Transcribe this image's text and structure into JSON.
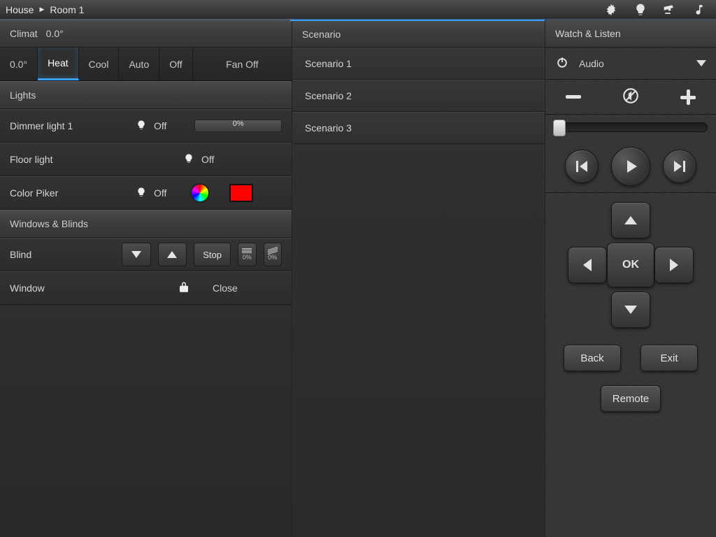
{
  "breadcrumb": {
    "root": "House",
    "room": "Room 1"
  },
  "climate": {
    "header": "Climat",
    "temp": "0.0°",
    "setpoint": "0.0°",
    "tabs": {
      "heat": "Heat",
      "cool": "Cool",
      "auto": "Auto",
      "off": "Off",
      "fanoff": "Fan Off"
    }
  },
  "lights": {
    "header": "Lights",
    "dimmer1": {
      "label": "Dimmer light 1",
      "status": "Off",
      "level": "0%"
    },
    "floor": {
      "label": "Floor light",
      "status": "Off"
    },
    "colorpicker": {
      "label": "Color Piker",
      "status": "Off",
      "swatch": "#ff0000"
    }
  },
  "blinds": {
    "header": "Windows & Blinds",
    "blind": {
      "label": "Blind",
      "stop": "Stop",
      "pct": "0%"
    },
    "window": {
      "label": "Window",
      "status": "Close"
    }
  },
  "scenario": {
    "header": "Scenario",
    "items": [
      "Scenario 1",
      "Scenario 2",
      "Scenario 3"
    ]
  },
  "right": {
    "header": "Watch & Listen",
    "audio": "Audio",
    "ok": "OK",
    "back": "Back",
    "exit": "Exit",
    "remote": "Remote"
  }
}
